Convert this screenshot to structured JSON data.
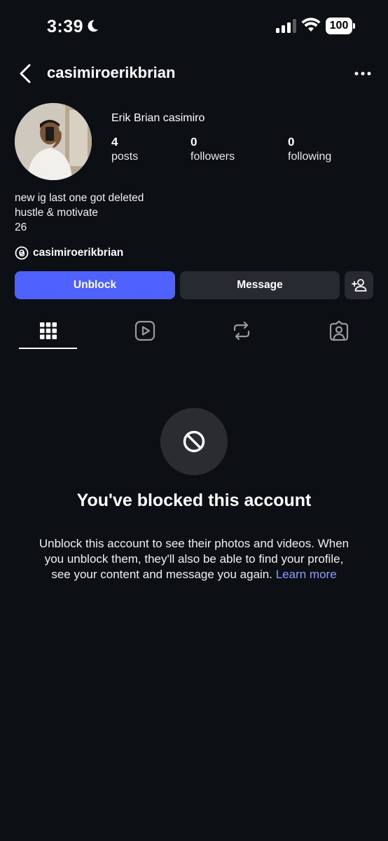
{
  "status_bar": {
    "time": "3:39",
    "battery": "100"
  },
  "header": {
    "username": "casimiroerikbrian"
  },
  "profile": {
    "display_name": "Erik Brian casimiro",
    "stats": [
      {
        "value": "4",
        "label": "posts"
      },
      {
        "value": "0",
        "label": "followers"
      },
      {
        "value": "0",
        "label": "following"
      }
    ],
    "bio": [
      "new ig last one got deleted",
      "hustle & motivate",
      "26"
    ],
    "threads_handle": "casimiroerikbrian"
  },
  "actions": {
    "unblock_label": "Unblock",
    "message_label": "Message"
  },
  "tabs": [
    {
      "icon": "grid-icon",
      "active": true
    },
    {
      "icon": "reels-icon",
      "active": false
    },
    {
      "icon": "reposts-icon",
      "active": false
    },
    {
      "icon": "tagged-icon",
      "active": false
    }
  ],
  "blocked": {
    "title": "You've blocked this account",
    "description": "Unblock this account to see their photos and videos. When you unblock them, they'll also be able to find your profile, see your content and message you again.",
    "learn_more": "Learn more"
  },
  "colors": {
    "background": "#0c0f14",
    "primary_button": "#4f61ff",
    "secondary_button": "#272a31",
    "link": "#8c9dff"
  }
}
